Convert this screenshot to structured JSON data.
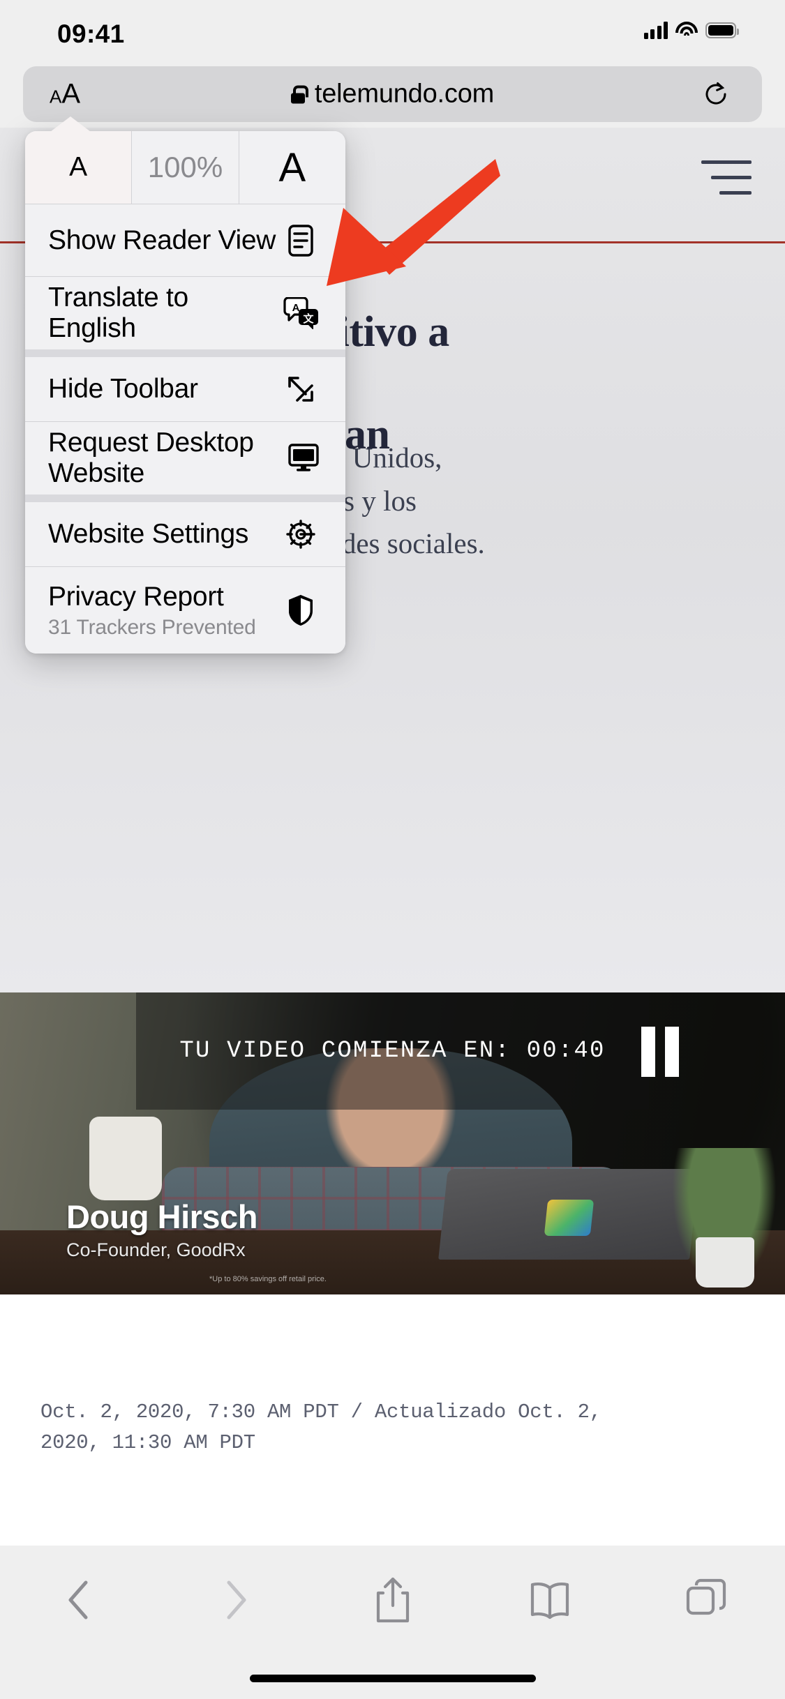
{
  "status_bar": {
    "time": "09:41",
    "cellular_icon": "signal-bars-icon",
    "wifi_icon": "wifi-icon",
    "battery_icon": "battery-full-icon"
  },
  "address_bar": {
    "text_size_button": {
      "small_a": "A",
      "large_a": "A"
    },
    "lock_icon": "lock-icon",
    "url": "telemundo.com",
    "reload_icon": "reload-icon"
  },
  "aa_menu": {
    "font_size_row": {
      "decrease_label": "A",
      "zoom_level": "100%",
      "increase_label": "A"
    },
    "items": [
      {
        "label": "Show Reader View",
        "icon": "reader-view-icon",
        "subtitle": ""
      },
      {
        "label": "Translate to English",
        "icon": "translate-icon",
        "subtitle": ""
      },
      {
        "label": "Hide Toolbar",
        "icon": "expand-arrows-icon",
        "subtitle": ""
      },
      {
        "label": "Request Desktop Website",
        "icon": "desktop-monitor-icon",
        "subtitle": ""
      },
      {
        "label": "Website Settings",
        "icon": "gear-icon",
        "subtitle": ""
      },
      {
        "label": "Privacy Report",
        "icon": "shield-icon",
        "subtitle": "31 Trackers Prevented"
      }
    ]
  },
  "annotation": {
    "arrow_color": "#ED3B20",
    "points_to": "Translate to English"
  },
  "webpage": {
    "menu_icon": "hamburger-menu-icon",
    "headline_line1": "sitivo a",
    "headline_line2": "nan",
    "deck_line1": "os Unidos,",
    "deck_line2": "rus y los",
    "deck_line3": "redes sociales.",
    "accent_rule_color": "#a33228",
    "headline_color": "#23263a",
    "video": {
      "countdown_text": "TU VIDEO COMIENZA EN: 00:40",
      "pause_icon": "pause-icon",
      "speaker_name": "Doug Hirsch",
      "speaker_role": "Co-Founder, GoodRx",
      "fine_print": "*Up to 80% savings off retail price."
    },
    "article_meta": {
      "date_line1": "Oct. 2, 2020, 7:30 AM PDT / Actualizado Oct. 2,",
      "date_line2": "2020, 11:30 AM PDT"
    }
  },
  "bottom_toolbar": {
    "back_icon": "chevron-left-icon",
    "forward_icon": "chevron-right-icon",
    "share_icon": "share-icon",
    "bookmarks_icon": "book-icon",
    "tabs_icon": "tabs-icon"
  }
}
